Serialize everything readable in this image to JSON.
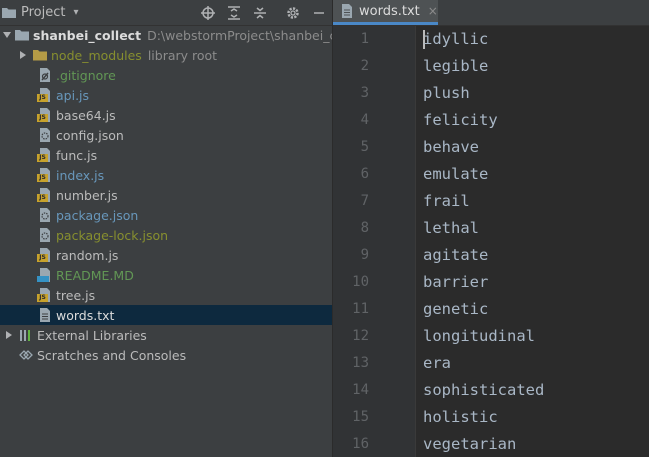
{
  "project_pane": {
    "title": "Project",
    "chevron": "▾",
    "toolbar_icons": [
      "locate-icon",
      "expand-all-icon",
      "collapse-all-icon",
      "settings-gear-icon",
      "hide-minus-icon"
    ]
  },
  "tree": {
    "root": {
      "name": "shanbei_collect",
      "path": "D:\\webstormProject\\shanbei_collect"
    },
    "node_modules": {
      "name": "node_modules",
      "hint": "library root"
    },
    "files": [
      {
        "name": ".gitignore",
        "icon": "gitignore-file-icon",
        "color": "c-green"
      },
      {
        "name": "api.js",
        "icon": "js-file-icon",
        "color": "c-blue"
      },
      {
        "name": "base64.js",
        "icon": "js-file-icon",
        "color": "c-default"
      },
      {
        "name": "config.json",
        "icon": "json-file-icon",
        "color": "c-default"
      },
      {
        "name": "func.js",
        "icon": "js-file-icon",
        "color": "c-default"
      },
      {
        "name": "index.js",
        "icon": "js-file-icon",
        "color": "c-blue"
      },
      {
        "name": "number.js",
        "icon": "js-file-icon",
        "color": "c-default"
      },
      {
        "name": "package.json",
        "icon": "json-file-icon",
        "color": "c-blue"
      },
      {
        "name": "package-lock.json",
        "icon": "json-file-icon",
        "color": "c-olive"
      },
      {
        "name": "random.js",
        "icon": "js-file-icon",
        "color": "c-default"
      },
      {
        "name": "README.MD",
        "icon": "markdown-file-icon",
        "color": "c-green"
      },
      {
        "name": "tree.js",
        "icon": "js-file-icon",
        "color": "c-default"
      },
      {
        "name": "words.txt",
        "icon": "text-file-icon",
        "color": "c-white",
        "selected": true
      }
    ],
    "external_libraries": "External Libraries",
    "scratches": "Scratches and Consoles"
  },
  "editor": {
    "tab": {
      "label": "words.txt",
      "close": "×"
    },
    "lines": [
      {
        "n": "1",
        "text": "idyllic"
      },
      {
        "n": "2",
        "text": "legible"
      },
      {
        "n": "3",
        "text": "plush"
      },
      {
        "n": "4",
        "text": "felicity"
      },
      {
        "n": "5",
        "text": "behave"
      },
      {
        "n": "6",
        "text": "emulate"
      },
      {
        "n": "7",
        "text": "frail"
      },
      {
        "n": "8",
        "text": "lethal"
      },
      {
        "n": "9",
        "text": "agitate"
      },
      {
        "n": "10",
        "text": "barrier"
      },
      {
        "n": "11",
        "text": "genetic"
      },
      {
        "n": "12",
        "text": "longitudinal"
      },
      {
        "n": "13",
        "text": "era"
      },
      {
        "n": "14",
        "text": "sophisticated"
      },
      {
        "n": "15",
        "text": "holistic"
      },
      {
        "n": "16",
        "text": "vegetarian"
      }
    ]
  },
  "colors": {
    "pane_bg": "#3c3f41",
    "editor_bg": "#2b2b2b",
    "selection": "#0d293e",
    "accent": "#4a88c7"
  }
}
